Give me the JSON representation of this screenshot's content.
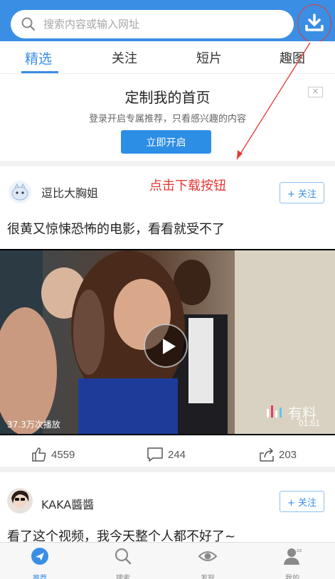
{
  "search": {
    "placeholder": "搜索内容或输入网址"
  },
  "tabs": [
    {
      "label": "精选"
    },
    {
      "label": "关注"
    },
    {
      "label": "短片"
    },
    {
      "label": "趣图"
    }
  ],
  "promo": {
    "title": "定制我的首页",
    "subtitle": "登录开启专属推荐，只看感兴趣的内容",
    "button": "立即开启",
    "close": "✕"
  },
  "annotation": "点击下载按钮",
  "posts": [
    {
      "author": "逗比大胸姐",
      "follow": "+ 关注",
      "title": "很黄又惊悚恐怖的电影，看看就受不了",
      "play_count": "37.3万次播放",
      "duration": "01:51",
      "watermark": "有料",
      "likes": "4559",
      "comments": "244",
      "shares": "203"
    },
    {
      "author": "KAKA醬醬",
      "follow": "+ 关注",
      "title": "看了这个视频，我今天整个人都不好了~"
    }
  ],
  "tabbar": [
    {
      "label": "推荐"
    },
    {
      "label": "搜索"
    },
    {
      "label": "发现"
    },
    {
      "label": "我的"
    }
  ],
  "colors": {
    "accent": "#3a8fe4",
    "annotation": "#e53935"
  }
}
